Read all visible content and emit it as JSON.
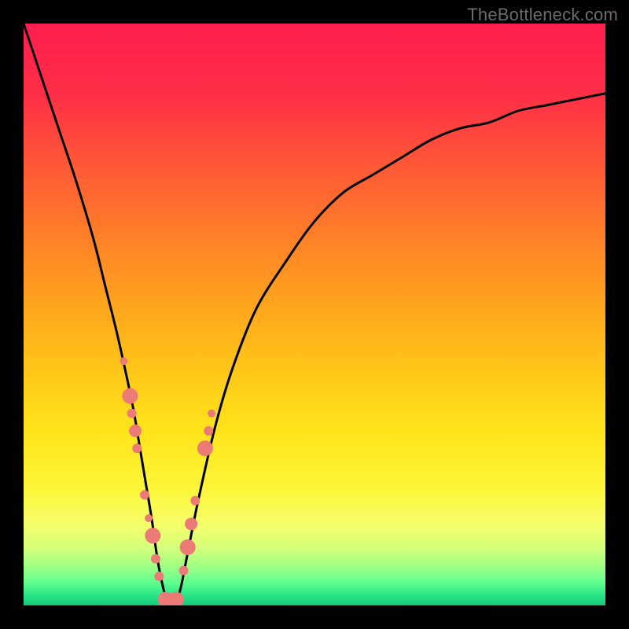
{
  "watermark": "TheBottleneck.com",
  "chart_data": {
    "type": "line",
    "title": "",
    "xlabel": "",
    "ylabel": "",
    "ylim": [
      0,
      100
    ],
    "xlim": [
      0,
      100
    ],
    "series": [
      {
        "name": "bottleneck-curve",
        "x": [
          0,
          3,
          6,
          9,
          12,
          14,
          16,
          18,
          19,
          20,
          21,
          22,
          23,
          24,
          25,
          26,
          27,
          28,
          30,
          33,
          36,
          40,
          45,
          50,
          55,
          60,
          65,
          70,
          75,
          80,
          85,
          90,
          95,
          100
        ],
        "y": [
          100,
          91,
          82,
          73,
          63,
          55,
          47,
          38,
          33,
          27,
          21,
          15,
          8,
          3,
          0,
          0,
          3,
          8,
          18,
          31,
          41,
          51,
          59,
          66,
          71,
          74,
          77,
          80,
          82,
          83,
          85,
          86,
          87,
          88
        ]
      }
    ],
    "markers": {
      "name": "data-points",
      "color": "#ec7a77",
      "points": [
        {
          "x": 17.2,
          "y": 42,
          "r": 5
        },
        {
          "x": 18.3,
          "y": 36,
          "r": 10
        },
        {
          "x": 18.6,
          "y": 33,
          "r": 6
        },
        {
          "x": 19.2,
          "y": 30,
          "r": 8
        },
        {
          "x": 19.5,
          "y": 27,
          "r": 6
        },
        {
          "x": 20.8,
          "y": 19,
          "r": 6
        },
        {
          "x": 21.5,
          "y": 15,
          "r": 5
        },
        {
          "x": 22.2,
          "y": 12,
          "r": 10
        },
        {
          "x": 22.7,
          "y": 8,
          "r": 6
        },
        {
          "x": 23.3,
          "y": 5,
          "r": 6
        },
        {
          "x": 24.4,
          "y": 1,
          "r": 10
        },
        {
          "x": 25.3,
          "y": 0,
          "r": 7
        },
        {
          "x": 26.2,
          "y": 1,
          "r": 10
        },
        {
          "x": 27.5,
          "y": 6,
          "r": 6
        },
        {
          "x": 28.2,
          "y": 10,
          "r": 10
        },
        {
          "x": 28.8,
          "y": 14,
          "r": 8
        },
        {
          "x": 29.5,
          "y": 18,
          "r": 6
        },
        {
          "x": 31.2,
          "y": 27,
          "r": 10
        },
        {
          "x": 31.8,
          "y": 30,
          "r": 6
        },
        {
          "x": 32.3,
          "y": 33,
          "r": 5
        }
      ]
    },
    "gradient_stops": [
      {
        "offset": 0,
        "color": "#ff1e4e"
      },
      {
        "offset": 12,
        "color": "#ff2e47"
      },
      {
        "offset": 25,
        "color": "#ff5a36"
      },
      {
        "offset": 40,
        "color": "#ff8a24"
      },
      {
        "offset": 55,
        "color": "#ffb919"
      },
      {
        "offset": 70,
        "color": "#ffe41a"
      },
      {
        "offset": 80,
        "color": "#fdf53a"
      },
      {
        "offset": 86,
        "color": "#f6ff6a"
      },
      {
        "offset": 90,
        "color": "#d6ff7a"
      },
      {
        "offset": 93,
        "color": "#a6ff85"
      },
      {
        "offset": 96,
        "color": "#63ff8e"
      },
      {
        "offset": 98,
        "color": "#2fe98a"
      },
      {
        "offset": 100,
        "color": "#12c878"
      }
    ],
    "green_floor": {
      "from_y_pct": 96.5,
      "to_y_pct": 100
    }
  }
}
